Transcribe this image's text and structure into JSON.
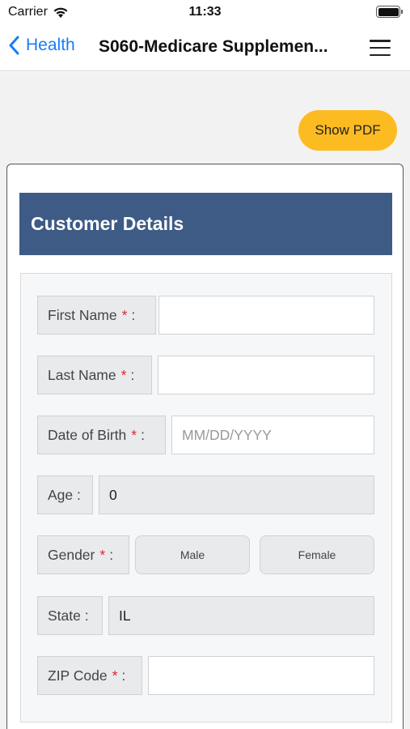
{
  "status_bar": {
    "carrier": "Carrier",
    "time": "11:33"
  },
  "nav": {
    "back_label": "Health",
    "title": "S060-Medicare Supplemen..."
  },
  "actions": {
    "show_pdf": "Show PDF"
  },
  "card": {
    "title": "Customer Details"
  },
  "form": {
    "first_name": {
      "label": "First Name",
      "required": "*",
      "colon": ":",
      "value": ""
    },
    "last_name": {
      "label": "Last Name",
      "required": "*",
      "colon": ":",
      "value": ""
    },
    "dob": {
      "label": "Date of Birth",
      "required": "*",
      "colon": ":",
      "value": "",
      "placeholder": "MM/DD/YYYY"
    },
    "age": {
      "label": "Age :",
      "value": "0"
    },
    "gender": {
      "label": "Gender",
      "required": "*",
      "colon": ":",
      "options": [
        "Male",
        "Female"
      ]
    },
    "state": {
      "label": "State :",
      "value": "IL"
    },
    "zip": {
      "label": "ZIP Code",
      "required": "*",
      "colon": ":",
      "value": ""
    }
  },
  "colors": {
    "accent_blue": "#1a7cf5",
    "header_bg": "#3e5b86",
    "pdf_button": "#fdbb22",
    "required": "#e0242a"
  }
}
